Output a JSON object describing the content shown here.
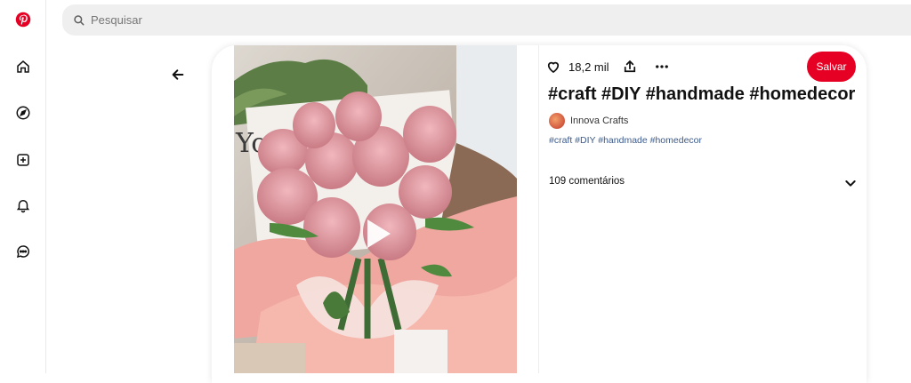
{
  "brand": {
    "logo_color": "#e60023"
  },
  "rail": {
    "items": [
      {
        "name": "pinterest-logo",
        "icon": "pinterest-logo"
      },
      {
        "name": "home",
        "icon": "home-icon"
      },
      {
        "name": "explore",
        "icon": "compass-icon"
      },
      {
        "name": "create",
        "icon": "plus-square-icon"
      },
      {
        "name": "notifications",
        "icon": "bell-icon"
      },
      {
        "name": "messages",
        "icon": "chat-icon"
      }
    ]
  },
  "search": {
    "placeholder": "Pesquisar",
    "value": ""
  },
  "pin": {
    "like_count": "18,2 mil",
    "save_label": "Salvar",
    "title": "#craft #DIY #handmade #homedecor",
    "author": "Innova Crafts",
    "tags": "#craft #DIY #handmade #homedecor",
    "comments_label": "109 comentários",
    "media": {
      "type": "video",
      "subject": "pink-tulip-pipe-cleaner-bouquet"
    }
  },
  "colors": {
    "accent": "#e60023",
    "tag_link": "#3c5a8a"
  }
}
